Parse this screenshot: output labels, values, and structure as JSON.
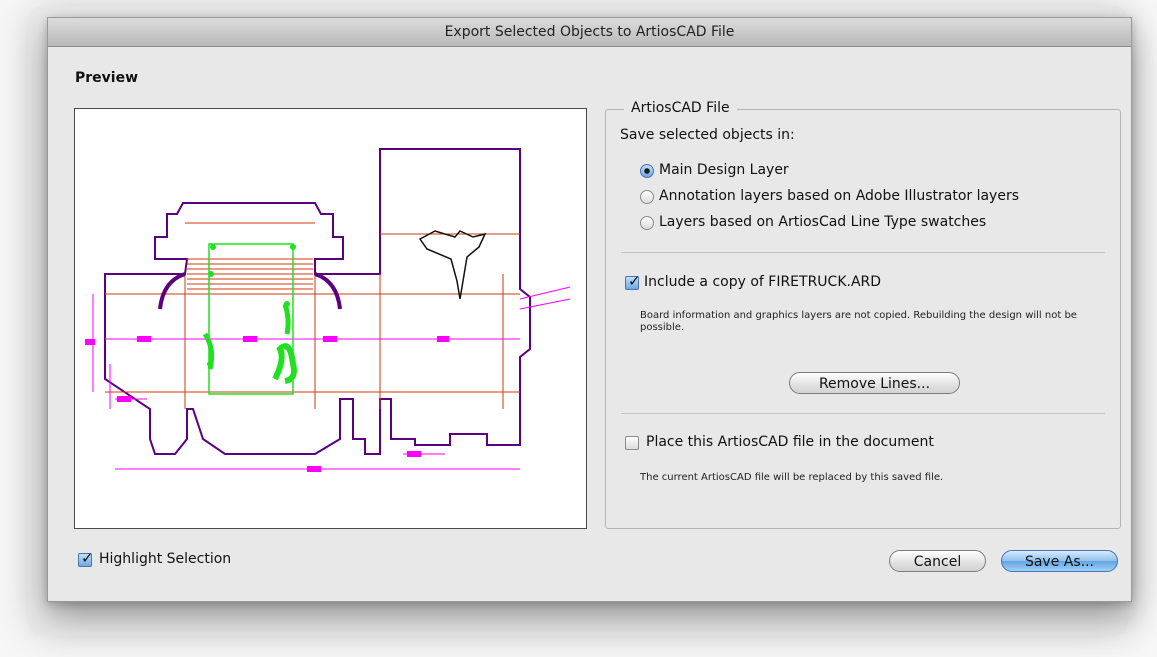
{
  "window": {
    "title": "Export Selected Objects to ArtiosCAD File"
  },
  "preview": {
    "label": "Preview"
  },
  "group": {
    "title": "ArtiosCAD File",
    "save_in_label": "Save selected objects in:",
    "options": [
      {
        "label": "Main Design Layer",
        "selected": true
      },
      {
        "label": "Annotation layers based on Adobe Illustrator layers",
        "selected": false
      },
      {
        "label": "Layers based on ArtiosCad Line Type swatches",
        "selected": false
      }
    ],
    "include_copy": {
      "label": "Include a copy of FIRETRUCK.ARD",
      "checked": true
    },
    "include_note": "Board information and graphics layers are not copied.  Rebuilding the design will not be possible.",
    "remove_lines_button": "Remove Lines...",
    "place_file": {
      "label": "Place this ArtiosCAD file in the document",
      "checked": false
    },
    "place_note": "The current ArtiosCAD file will be replaced by this saved file."
  },
  "highlight_selection": {
    "label": "Highlight Selection",
    "checked": true
  },
  "buttons": {
    "cancel": "Cancel",
    "save_as": "Save As..."
  },
  "colors": {
    "accent": "#63a4e4",
    "dieline": "#5a0080",
    "cut": "#d03a10",
    "dimension": "#ff00ff",
    "selection": "#20e020"
  }
}
